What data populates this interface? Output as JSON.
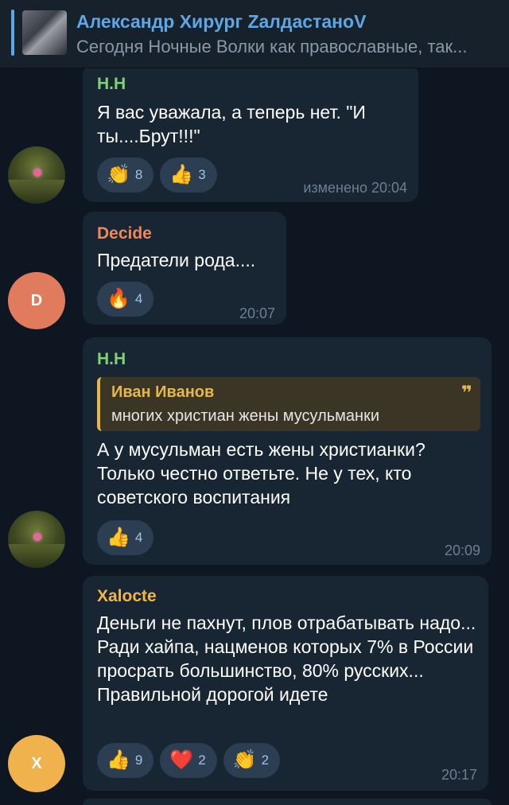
{
  "pinned": {
    "title": "Александр Хирург ZалдастаноV",
    "text": "Сегодня Ночные Волки как православные, так..."
  },
  "messages": [
    {
      "author": "Н.Н",
      "author_color": "#7fd472",
      "text": "Я вас уважала, а теперь нет. \"И ты....Брут!!!\"",
      "time": "изменено 20:04",
      "reactions": [
        {
          "emoji": "👏",
          "count": "8"
        },
        {
          "emoji": "👍",
          "count": "3"
        }
      ]
    },
    {
      "author": "Decide",
      "author_color": "#f0875a",
      "avatar_letter": "D",
      "avatar_color": "#e07c5d",
      "text": "Предатели рода....",
      "time": "20:07",
      "reactions": [
        {
          "emoji": "🔥",
          "count": "4"
        }
      ]
    },
    {
      "author": "Н.Н",
      "author_color": "#7fd472",
      "quote": {
        "author": "Иван Иванов",
        "text": "многих христиан жены мусульманки",
        "mark": "❞"
      },
      "text": "А у мусульман есть жены христианки? Только честно ответьте. Не у тех, кто советского воспитания",
      "time": "20:09",
      "reactions": [
        {
          "emoji": "👍",
          "count": "4"
        }
      ]
    },
    {
      "author": "Xalocte",
      "author_color": "#f2b54a",
      "avatar_letter": "X",
      "avatar_color": "#f0b24c",
      "text": "Деньги не пахнут, плов отрабатывать надо... Ради хайпа, нацменов которых 7% в России просрать большинство, 80% русских... Правильной дорогой идете",
      "time": "20:17",
      "reactions": [
        {
          "emoji": "👍",
          "count": "9"
        },
        {
          "emoji": "❤️",
          "count": "2"
        },
        {
          "emoji": "👏",
          "count": "2"
        }
      ]
    }
  ]
}
